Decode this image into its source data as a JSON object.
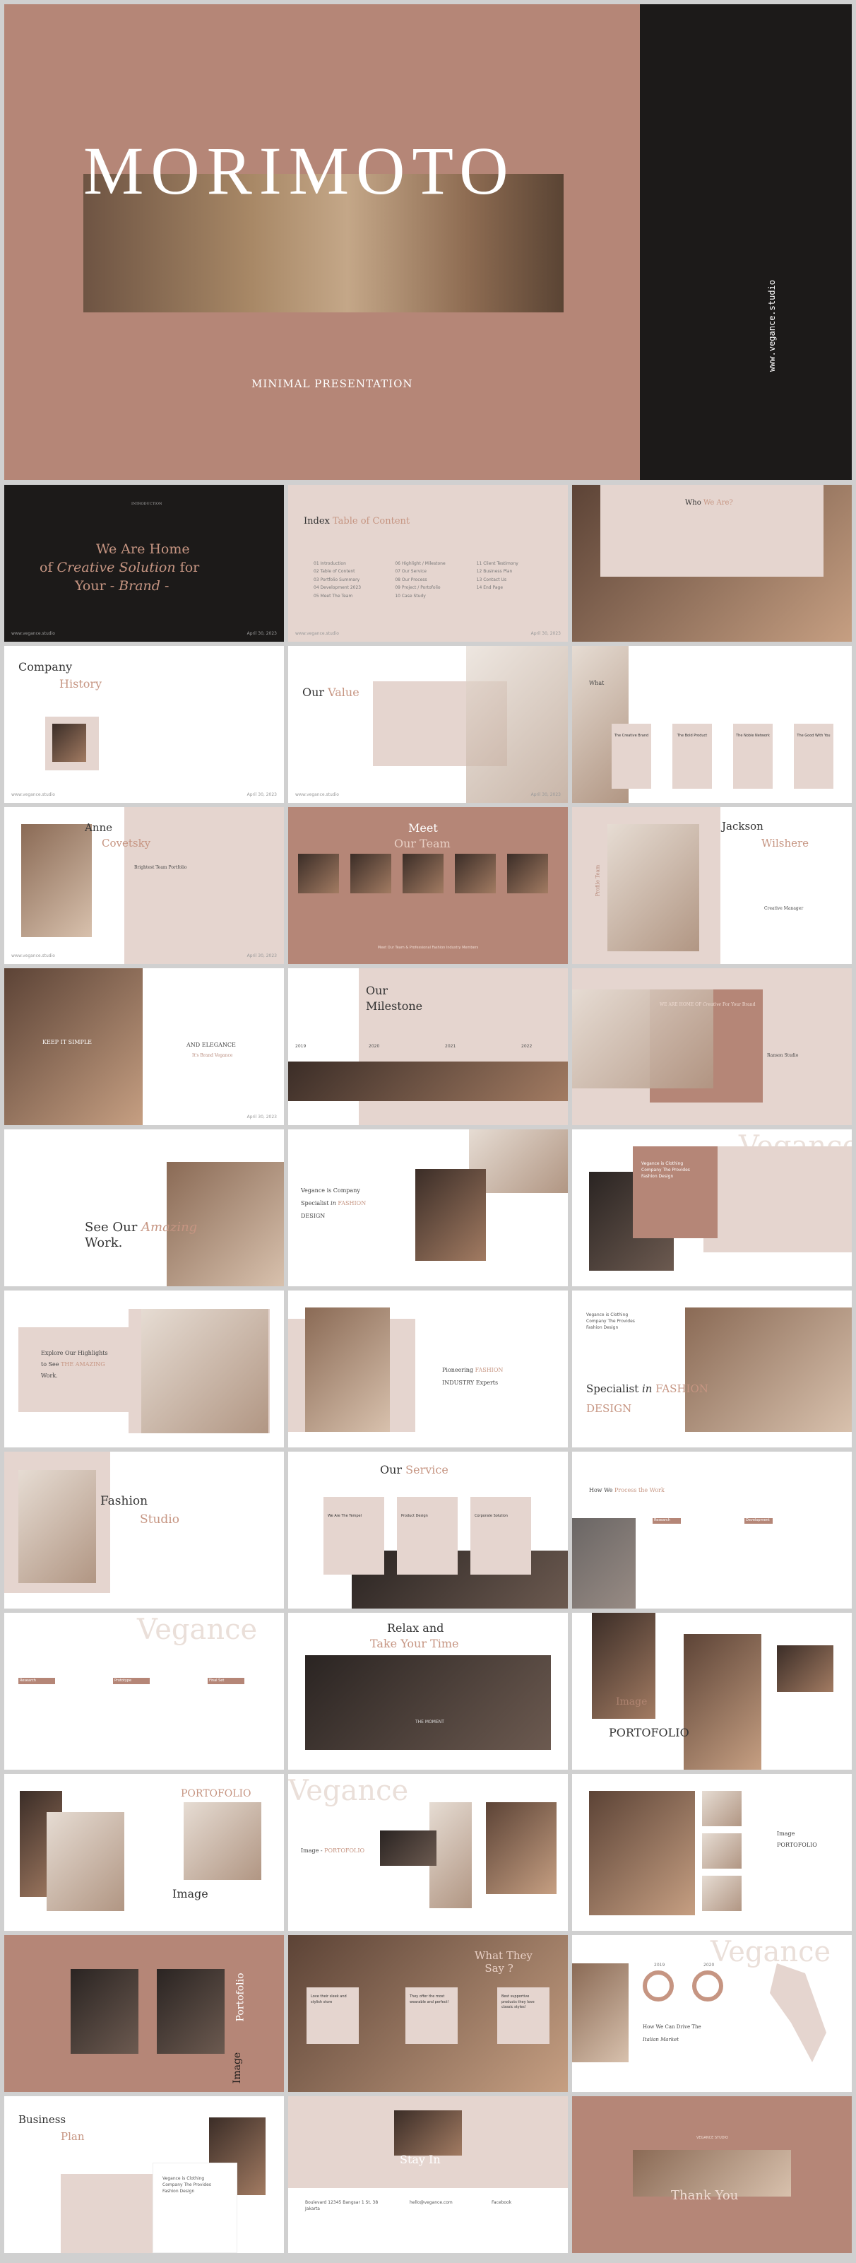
{
  "hero": {
    "title": "MORIMOTO",
    "subtitle": "MINIMAL PRESENTATION",
    "url": "www.vegance.studio"
  },
  "slides": {
    "s1": {
      "kicker": "INTRODUCTION",
      "line1": "We Are Home",
      "line2a": "of",
      "line2b": "Creative Solution",
      "line2c": "for",
      "line3a": "Your",
      "line3b": "Brand"
    },
    "s2": {
      "title_a": "Index",
      "title_b": "Table of Content",
      "items": [
        "01 Introduction",
        "02 Table of Content",
        "03 Portfolio Summary",
        "04 Development 2023",
        "05 Meet The Team",
        "06 Highlight / Milestone",
        "07 Our Service",
        "08 Our Process",
        "09 Project / Portofolio",
        "10 Case Study",
        "11 Client Testimony",
        "12 Business Plan",
        "13 Contact Us",
        "14 End Page"
      ]
    },
    "s3": {
      "title_a": "Who",
      "title_b": "We Are?"
    },
    "s4": {
      "title_a": "Company",
      "title_b": "History"
    },
    "s5": {
      "title_a": "Our",
      "title_b": "Value"
    },
    "s6": {
      "title": "What",
      "items": [
        "The Creative Brand",
        "The Bold Product",
        "The Noble Network",
        "The Good With You"
      ]
    },
    "s7": {
      "title_a": "Anne",
      "title_b": "Covetsky",
      "role": "Brightest Team Portfolio"
    },
    "s8": {
      "title_a": "Meet",
      "title_b": "Our Team",
      "footer": "Meet Our Team & Professional Fashion Industry Members"
    },
    "s9": {
      "title_a": "Jackson",
      "title_b": "Wilshere",
      "side": "Profile Team",
      "role": "Creative Manager"
    },
    "s10": {
      "line1": "KEEP IT SIMPLE",
      "line2": "AND ELEGANCE",
      "line3": "It's Brand Vegance"
    },
    "s11": {
      "title_a": "Our",
      "title_b": "Milestone",
      "years": [
        "2019",
        "2020",
        "2021",
        "2022"
      ]
    },
    "s12": {
      "title_a": "WE ARE HOME OF",
      "title_b": "Creative",
      "title_c": "For Your Brand",
      "caption": "Ranson Studio"
    },
    "s13": {
      "title_a": "See Our",
      "title_b": "Amazing",
      "title_c": "Work."
    },
    "s14": {
      "title_a": "Vegance is Company",
      "title_b": "Specialist",
      "title_c": "in",
      "title_d": "FASHION",
      "title_e": "DESIGN"
    },
    "s15": {
      "watermark": "Vegance",
      "caption_a": "Vegance is Clothing",
      "caption_b": "Company The Provides",
      "caption_c": "Fashion Design"
    },
    "s16": {
      "title_a": "Explore Our Highlights",
      "title_b": "to See",
      "title_c": "THE AMAZING",
      "title_d": "Work."
    },
    "s17": {
      "title_a": "Pioneering",
      "title_b": "FASHION",
      "title_c": "INDUSTRY Experts"
    },
    "s18": {
      "caption_a": "Vegance is Clothing",
      "caption_b": "Company The Provides",
      "caption_c": "Fashion Design",
      "title_a": "Specialist",
      "title_b": "in",
      "title_c": "FASHION",
      "title_d": "DESIGN"
    },
    "s19": {
      "title_a": "Fashion",
      "title_b": "Studio"
    },
    "s20": {
      "title_a": "Our",
      "title_b": "Service",
      "items": [
        "We Are The Tempel",
        "Product Design",
        "Corporate Solution"
      ]
    },
    "s21": {
      "title_a": "How We",
      "title_b": "Process the Work",
      "items": [
        "Research",
        "Development"
      ]
    },
    "s22": {
      "watermark": "Vegance",
      "items": [
        "Research",
        "Prototype",
        "Final Set"
      ]
    },
    "s23": {
      "title_a": "Relax and",
      "title_b": "Take Your Time",
      "caption": "THE MOMENT"
    },
    "s24": {
      "title_a": "Image",
      "title_b": "PORTOFOLIO"
    },
    "s25": {
      "title_a": "PORTOFOLIO",
      "title_b": "Image"
    },
    "s26": {
      "watermark": "Vegance",
      "title_a": "Image",
      "title_b": "PORTOFOLIO"
    },
    "s27": {
      "title_a": "Image",
      "title_b": "PORTOFOLIO"
    },
    "s28": {
      "title_a": "Portofolio",
      "title_b": "Image"
    },
    "s29": {
      "title_a": "What",
      "title_b": "They",
      "title_c": "Say ?",
      "quotes": [
        "Love their sleek and stylish store",
        "They offer the most wearable and perfect!",
        "Best supportive products they love classic styles!"
      ]
    },
    "s30": {
      "watermark": "Vegance",
      "years": [
        "2019",
        "2020"
      ],
      "title_a": "How We Can Drive The",
      "title_b": "Italian Market"
    },
    "s31": {
      "title_a": "Business",
      "title_b": "Plan",
      "caption_a": "Vegance is Clothing",
      "caption_b": "Company The Provides",
      "caption_c": "Fashion Design"
    },
    "s32": {
      "title": "Stay In",
      "col1": "Boulevard 12345 Bangsar 1 St. 38 Jakarta",
      "col2": "hello@vegance.com",
      "col3": "Facebook"
    },
    "s33": {
      "kicker": "VEGANCE STUDIO",
      "title": "Thank You"
    }
  },
  "footer": {
    "brand": "www.vegance.studio",
    "date": "April 30, 2023"
  }
}
